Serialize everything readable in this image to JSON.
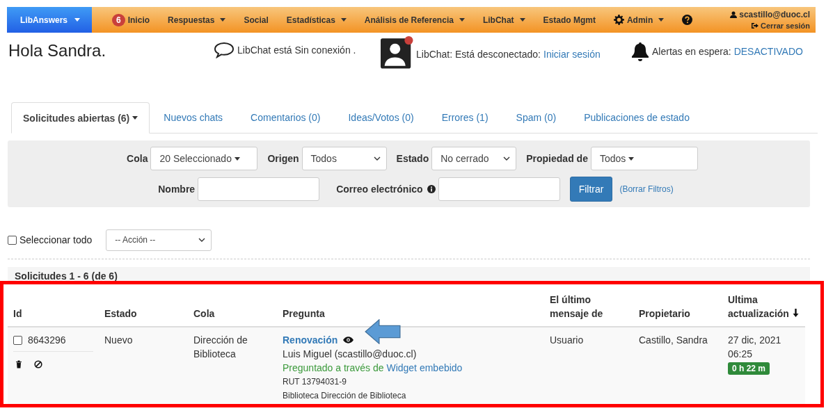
{
  "nav": {
    "brand": "LibAnswers",
    "items": [
      {
        "label": "Inicio",
        "badge": "6",
        "kind": "link"
      },
      {
        "label": "Respuestas",
        "kind": "menu"
      },
      {
        "label": "Social",
        "kind": "link"
      },
      {
        "label": "Estadísticas",
        "kind": "menu"
      },
      {
        "label": "Análisis de Referencia",
        "kind": "menu"
      },
      {
        "label": "LibChat",
        "kind": "menu"
      },
      {
        "label": "Estado Mgmt",
        "kind": "link"
      },
      {
        "label": "Admin",
        "kind": "settings"
      },
      {
        "kind": "help"
      }
    ],
    "user": {
      "email": "scastillo@duoc.cl",
      "logout": "Cerrar sesión"
    }
  },
  "header": {
    "greeting": "Hola Sandra.",
    "chat_status": "LibChat está Sin conexión .",
    "libchat": {
      "text": "LibChat: Está desconectado:",
      "link": "Iniciar sesión"
    },
    "alerts": {
      "text": "Alertas en espera:",
      "link": "DESACTIVADO"
    }
  },
  "tabs": [
    {
      "label": "Solicitudes abiertas (6)",
      "selected": true,
      "kind": "menu"
    },
    {
      "label": "Nuevos chats",
      "selected": false,
      "kind": "link"
    },
    {
      "label": "Comentarios (0)",
      "selected": false,
      "kind": "link"
    },
    {
      "label": "Ideas/Votos (0)",
      "selected": false,
      "kind": "link"
    },
    {
      "label": "Errores (1)",
      "selected": false,
      "kind": "link"
    },
    {
      "label": "Spam (0)",
      "selected": false,
      "kind": "link"
    },
    {
      "label": "Publicaciones de estado",
      "selected": false,
      "kind": "link"
    }
  ],
  "filters": {
    "row1": [
      {
        "label": "Cola",
        "kind": "dropdown",
        "value": "20 Seleccionado"
      },
      {
        "label": "Origen",
        "kind": "select",
        "value": "Todos"
      },
      {
        "label": "Estado",
        "kind": "select",
        "value": "No cerrado"
      },
      {
        "label": "Propiedad de",
        "kind": "dropdown",
        "value": "Todos"
      }
    ],
    "row2": [
      {
        "label": "Nombre",
        "kind": "input"
      },
      {
        "label": "Correo electrónico",
        "kind": "input_info"
      }
    ],
    "submit": "Filtrar",
    "clear": "(Borrar Filtros)"
  },
  "select_all": {
    "label": "Seleccionar todo",
    "checked": false
  },
  "action": {
    "value": "-- Acción --"
  },
  "results_title": "Solicitudes 1 - 6 (de 6)",
  "table": {
    "columns": [
      {
        "label": "Id",
        "sorted": false
      },
      {
        "label": "Estado",
        "sorted": false
      },
      {
        "label": "Cola",
        "sorted": false
      },
      {
        "label": "Pregunta",
        "sorted": false
      },
      {
        "label": "El último mensaje de",
        "sorted": false
      },
      {
        "label": "Propietario",
        "sorted": false
      },
      {
        "label": "Ultima actualización",
        "sorted": true
      }
    ],
    "rows": [
      {
        "id": "8643296",
        "checked": false,
        "estado": "Nuevo",
        "cola": "Dirección de Biblioteca",
        "title": "Renovación",
        "from": "Luis Miguel (scastillo@duoc.cl)",
        "via": "Preguntado a través de",
        "via_link": "Widget embebido",
        "rut": "RUT 13794031-9",
        "branch": "Biblioteca Dirección de Biblioteca",
        "last_message": "Usuario",
        "owner": "Castillo, Sandra",
        "updated": "27 dic, 2021 06:25",
        "elapsed": "0 h 22 m"
      }
    ]
  }
}
